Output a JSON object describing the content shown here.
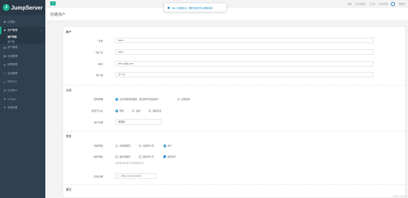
{
  "app": {
    "logo_text": "JumpServer"
  },
  "sidebar": {
    "items": [
      {
        "label": "仪表盘",
        "icon": "dashboard-icon",
        "glyph": "▣"
      },
      {
        "label": "用户管理",
        "icon": "users-icon",
        "glyph": "♟",
        "active": true,
        "children": [
          {
            "label": "用户列表",
            "on": true
          },
          {
            "label": "用户组",
            "on": false
          }
        ]
      },
      {
        "label": "资产管理",
        "icon": "assets-icon",
        "glyph": "▤"
      },
      {
        "label": "应用管理",
        "icon": "apps-icon",
        "glyph": "▦"
      },
      {
        "label": "权限管理",
        "icon": "permissions-icon",
        "glyph": "◈"
      },
      {
        "label": "会话管理",
        "icon": "sessions-icon",
        "glyph": "▭"
      },
      {
        "label": "作业中心",
        "icon": "jobs-icon",
        "glyph": "◎"
      },
      {
        "label": "日志审计",
        "icon": "audit-icon",
        "glyph": "▥"
      },
      {
        "label": "X-Pack",
        "icon": "xpack-icon",
        "glyph": "✚"
      },
      {
        "label": "系统设置",
        "icon": "settings-icon",
        "glyph": "⚙"
      }
    ]
  },
  "toast": {
    "text": "test-c 创建成功，更新内容在可以继续添加"
  },
  "topnav": {
    "help": "帮助",
    "language": "中文(简体)",
    "workbench": "工作台",
    "web_terminal": "Web终端",
    "user": "管理员"
  },
  "header": {
    "title": "创建用户"
  },
  "form": {
    "sections": {
      "account": "账户",
      "auth": "认证",
      "security": "安全",
      "other": "其它"
    },
    "name": {
      "label": "名称",
      "value": "test-c"
    },
    "username": {
      "label": "用户名",
      "value": "test-c"
    },
    "email": {
      "label": "邮件",
      "value": "test-c@jsj.com"
    },
    "group": {
      "label": "用户组",
      "placeholder": "用户组"
    },
    "password_strategy": {
      "label": "密码策略",
      "options": [
        "生成重置密码链接，通过邮件发送给用户",
        "设置密码"
      ],
      "selected": 0
    },
    "mfa": {
      "label": "多因子认证",
      "options": [
        "禁用",
        "启用",
        "强制启用"
      ],
      "selected": 0
    },
    "source": {
      "label": "用户来源",
      "value": "数据库"
    },
    "system_role": {
      "label": "系统角色",
      "options": [
        "系统管理员",
        "系统审计员",
        "用户"
      ],
      "selected": 2
    },
    "org_role": {
      "label": "组织角色",
      "options": [
        "组织管理员",
        "组织审计员",
        "组织用户"
      ],
      "selected": [
        2
      ]
    },
    "org_role_hint": "组织角色用户能下访问的组织信息",
    "expire": {
      "label": "失效日期",
      "value": "2093-10-26 18:44:30"
    }
  },
  "footer": {
    "text": "Version: v2.xx.xx"
  }
}
